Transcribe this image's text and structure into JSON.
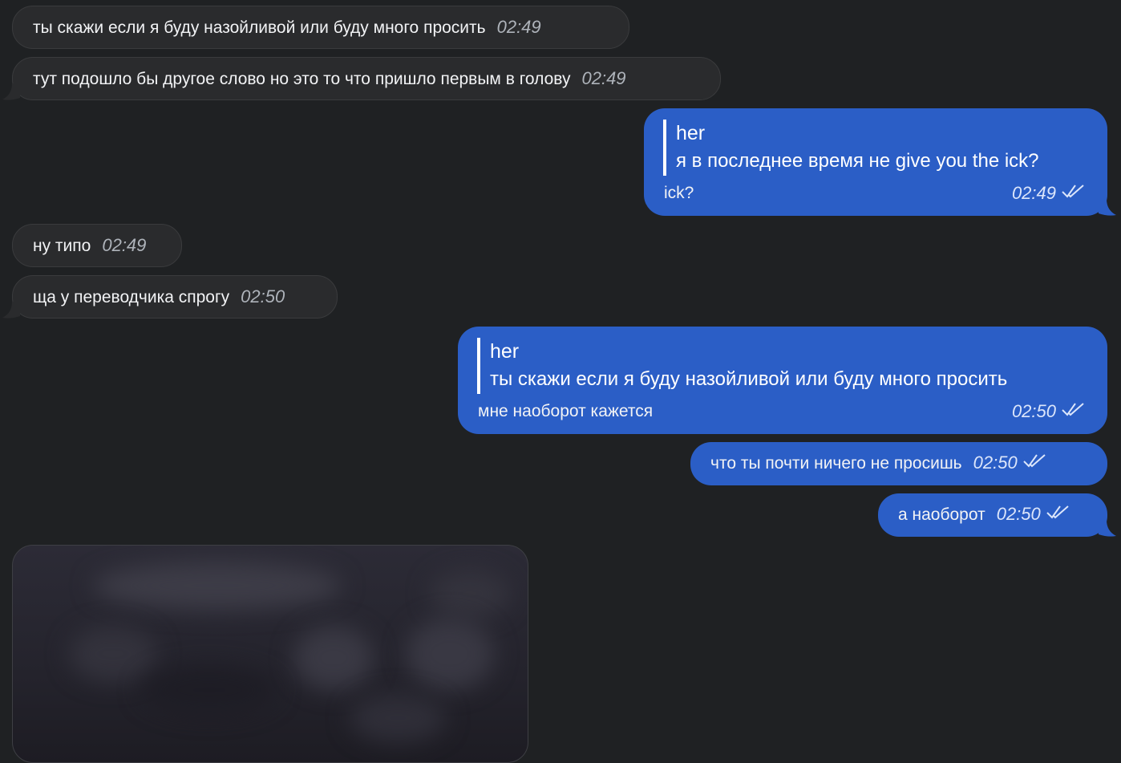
{
  "messages": [
    {
      "text": "ты скажи если я буду назойливой или буду много просить",
      "time": "02:49"
    },
    {
      "text": "тут подошло бы другое слово но это то что пришло первым в голову",
      "time": "02:49"
    },
    {
      "reply_author": "her",
      "reply_text": "я в последнее время не give you the ick?",
      "text": "ick?",
      "time": "02:49"
    },
    {
      "text": "ну типо",
      "time": "02:49"
    },
    {
      "text": "ща у переводчика спрогу",
      "time": "02:50"
    },
    {
      "reply_author": "her",
      "reply_text": "ты скажи если я буду назойливой или буду много просить",
      "text": "мне наоборот кажется",
      "time": "02:50"
    },
    {
      "text": "что ты почти ничего не просишь",
      "time": "02:50"
    },
    {
      "text": "а наоборот",
      "time": "02:50"
    }
  ],
  "colors": {
    "background": "#1f2123",
    "incoming_bubble": "#2a2b2d",
    "outgoing_bubble": "#2b5ec6"
  },
  "icons": {
    "read_status": "double-check-icon"
  }
}
